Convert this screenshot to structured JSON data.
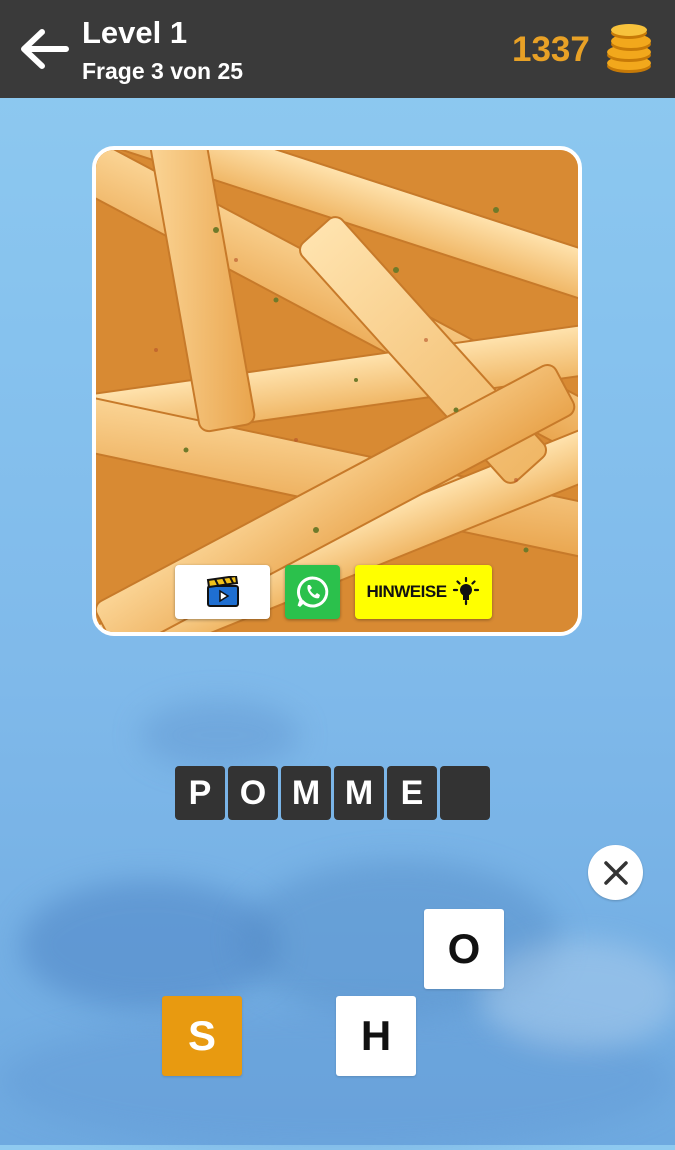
{
  "header": {
    "title": "Level 1",
    "subtitle": "Frage 3 von 25",
    "coins": "1337",
    "back_icon": "arrow-left-icon",
    "coins_icon": "coin-stack-icon"
  },
  "photo": {
    "subject": "french-fries"
  },
  "actions": {
    "video_icon": "clapperboard-play-icon",
    "whatsapp_icon": "whatsapp-icon",
    "hints_label": "HINWEISE",
    "hints_icon": "lightbulb-icon"
  },
  "answer": {
    "slots": [
      "P",
      "O",
      "M",
      "M",
      "E",
      ""
    ]
  },
  "clear_icon": "close-icon",
  "letters": [
    {
      "letter": "O",
      "style": "white"
    },
    {
      "letter": "S",
      "style": "orange"
    },
    {
      "letter": "H",
      "style": "white"
    }
  ],
  "colors": {
    "header_bg": "#3a3a3a",
    "coins": "#e8a126",
    "hints_bg": "#ffff00",
    "whatsapp": "#2bc14c",
    "slot_bg": "#333333",
    "tile_orange": "#e89a10"
  }
}
